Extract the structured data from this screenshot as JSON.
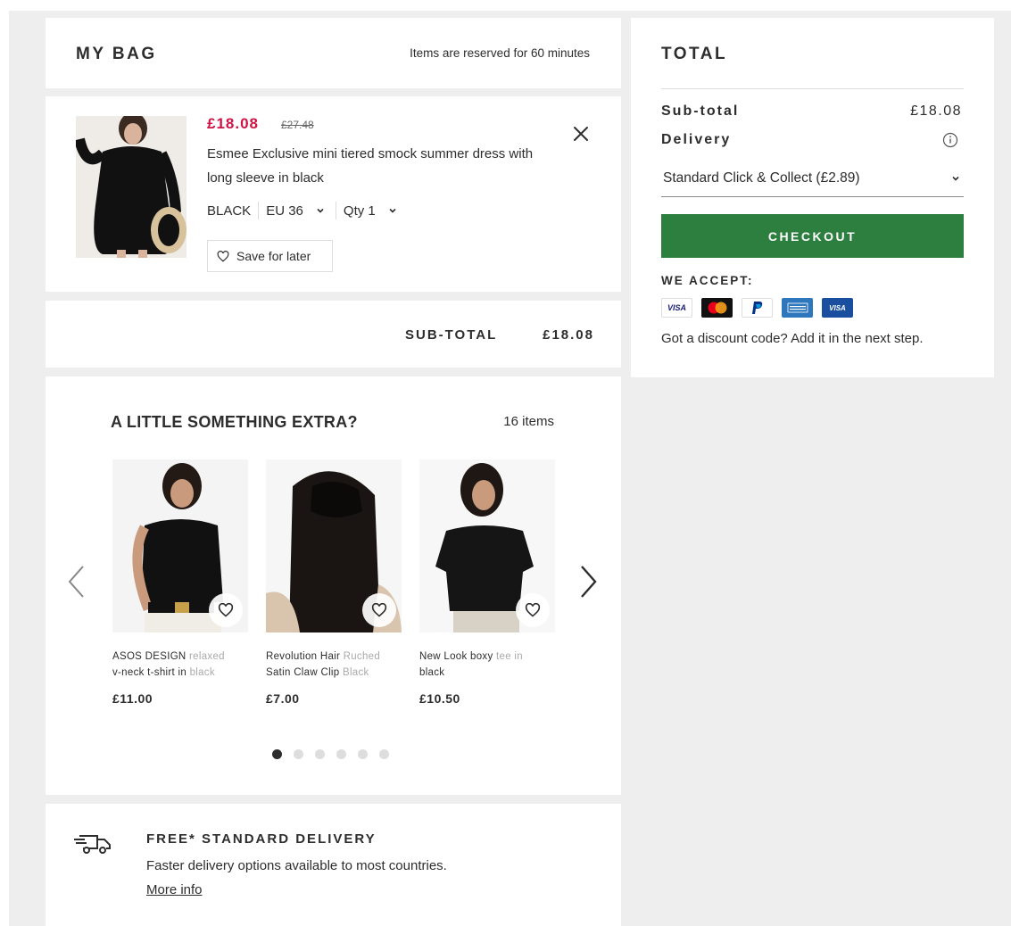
{
  "bag": {
    "title": "MY BAG",
    "reserve_note": "Items are reserved for 60 minutes"
  },
  "item": {
    "price_now": "£18.08",
    "price_was": "£27.48",
    "name": "Esmee Exclusive mini tiered smock summer dress with long sleeve in black",
    "colour": "BLACK",
    "size": "EU 36",
    "qty": "Qty 1",
    "save_label": "Save for later"
  },
  "subtotal": {
    "label": "SUB-TOTAL",
    "value": "£18.08"
  },
  "extras": {
    "title": "A LITTLE SOMETHING EXTRA?",
    "count": "16 items",
    "products": [
      {
        "name_main": "ASOS DESIGN ",
        "name_fade": "relaxed",
        "name_rest": "v-neck t-shirt in ",
        "name_rest_fade": "black",
        "price": "£11.00"
      },
      {
        "name_main": "Revolution Hair ",
        "name_fade": "Ruched",
        "name_rest": "Satin Claw Clip ",
        "name_rest_fade": "Black",
        "price": "£7.00"
      },
      {
        "name_main": "New Look boxy ",
        "name_fade": "tee in",
        "name_rest": "black",
        "name_rest_fade": "",
        "price": "£10.50"
      }
    ],
    "dots": [
      true,
      false,
      false,
      false,
      false,
      false
    ]
  },
  "delivery": {
    "title": "FREE* STANDARD DELIVERY",
    "description": "Faster delivery options available to most countries.",
    "more": "More info"
  },
  "total": {
    "title": "TOTAL",
    "subtotal_label": "Sub-total",
    "subtotal_value": "£18.08",
    "delivery_label": "Delivery",
    "delivery_option": "Standard Click & Collect (£2.89)",
    "checkout": "CHECKOUT",
    "accept": "WE ACCEPT:",
    "payment_methods": [
      "visa-icon",
      "mastercard-icon",
      "paypal-icon",
      "amex-icon",
      "visa-electron-icon"
    ],
    "discount_note": "Got a discount code? Add it in the next step."
  },
  "colors": {
    "sale_red": "#d01345",
    "checkout_green": "#2c7f3e",
    "page_bg": "#eeeeee",
    "text": "#2d2d2d"
  }
}
